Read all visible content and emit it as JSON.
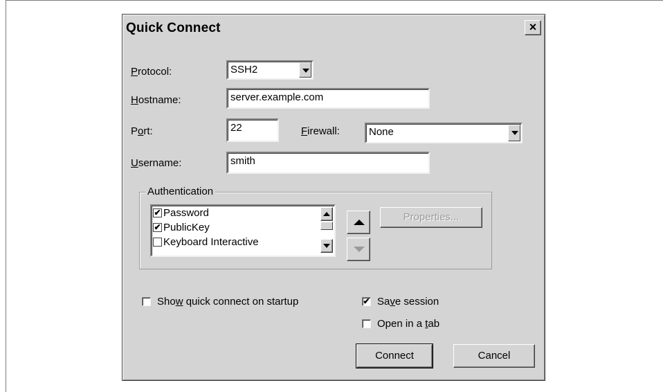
{
  "dialog": {
    "title": "Quick Connect",
    "close_glyph": "×"
  },
  "form": {
    "protocol": {
      "label_ul": "P",
      "label_rest": "rotocol:",
      "value": "SSH2"
    },
    "hostname": {
      "label_ul": "H",
      "label_rest": "ostname:",
      "value": "server.example.com"
    },
    "port": {
      "label_pre": "P",
      "label_ul": "o",
      "label_rest": "rt:",
      "value": "22"
    },
    "firewall": {
      "label_ul": "F",
      "label_rest": "irewall:",
      "value": "None"
    },
    "username": {
      "label_ul": "U",
      "label_rest": "sername:",
      "value": "smith"
    }
  },
  "authentication": {
    "group_label": "Authentication",
    "methods": [
      {
        "label": "Password",
        "checked": true
      },
      {
        "label": "PublicKey",
        "checked": true
      },
      {
        "label": "Keyboard Interactive",
        "checked": false
      }
    ],
    "properties_label": "Properties..."
  },
  "options": {
    "show_quick_connect": {
      "pre": "Sho",
      "ul": "w",
      "rest": " quick connect on startup",
      "checked": false
    },
    "save_session": {
      "pre": "Sa",
      "ul": "v",
      "rest": "e session",
      "checked": true
    },
    "open_in_tab": {
      "pre": "Open in a ",
      "ul": "t",
      "rest": "ab",
      "checked": false
    }
  },
  "buttons": {
    "connect": "Connect",
    "cancel": "Cancel"
  },
  "glyphs": {
    "check": "✔"
  }
}
